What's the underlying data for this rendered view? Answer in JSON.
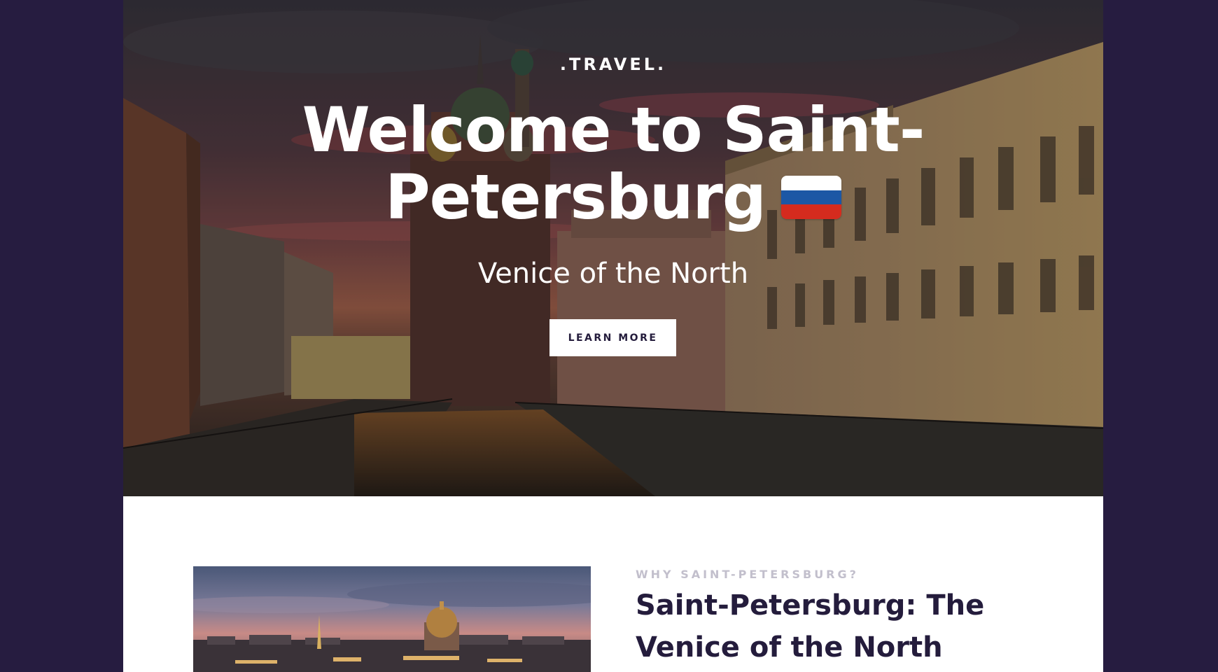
{
  "hero": {
    "brand": ".TRAVEL.",
    "title": "Welcome to Saint-Petersburg",
    "flag": "russia-flag",
    "subtitle": "Venice of the North",
    "cta_label": "LEARN MORE"
  },
  "intro": {
    "eyebrow": "WHY SAINT-PETERSBURG?",
    "title": "Saint-Petersburg: The Venice of the North"
  },
  "colors": {
    "outer_background": "#261c40",
    "heading": "#241c3c",
    "eyebrow": "#c2bfcc",
    "flag_white": "#ffffff",
    "flag_blue": "#1c57a5",
    "flag_red": "#d52b1e"
  }
}
